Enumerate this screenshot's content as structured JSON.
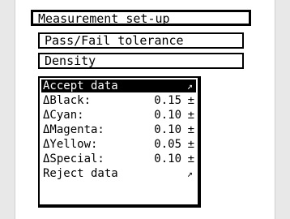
{
  "menu": {
    "title": "Measurement set-up",
    "item_tolerance": "Pass/Fail tolerance",
    "item_density": "Density"
  },
  "popup": {
    "accept": "Accept data",
    "reject": "Reject data",
    "arrow_glyph": "↗",
    "rows": [
      {
        "label": "ΔBlack:",
        "value": "0.15",
        "sign": "±"
      },
      {
        "label": "ΔCyan:",
        "value": "0.10",
        "sign": "±"
      },
      {
        "label": "ΔMagenta:",
        "value": "0.10",
        "sign": "±"
      },
      {
        "label": "ΔYellow:",
        "value": "0.05",
        "sign": "±"
      },
      {
        "label": "ΔSpecial:",
        "value": "0.10",
        "sign": "±"
      }
    ]
  }
}
